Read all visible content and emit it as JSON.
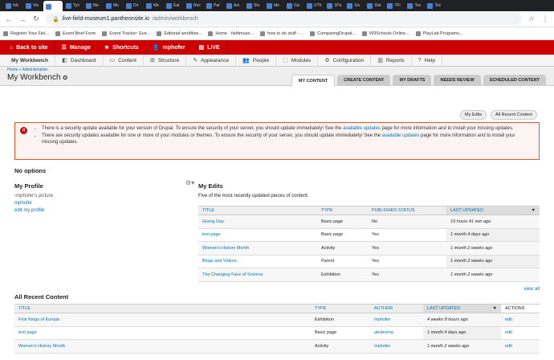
{
  "browser": {
    "tabs": [
      "Inb",
      "Vie",
      "",
      "Tyn",
      "Me",
      "Me",
      "Dir",
      "Me",
      "Ear",
      "Rec",
      "Par",
      "Asi",
      "Sto",
      "Me",
      "Giv",
      "UTh",
      "1Pa",
      "Go",
      "Dat",
      "TFi",
      "Tex",
      "Tec"
    ],
    "url_host": "live-field-museum1.pantheonsite.io",
    "url_path": "/admin/workbench",
    "bookmarks": [
      "Register Your Fiel...",
      "Event Brief Form",
      "Event Tracker: Eve...",
      "Editorial workflow...",
      "Home · fieldmuse...",
      "how to do stuff - ...",
      "ComparingDrupal...",
      "W3Schools Online...",
      "PlayLab Programs..."
    ]
  },
  "toolbar": {
    "back": "Back to site",
    "manage": "Manage",
    "shortcuts": "Shortcuts",
    "user": "mphofer",
    "live": "LIVE"
  },
  "admin_menu": [
    "My Workbench",
    "Dashboard",
    "Content",
    "Structure",
    "Appearance",
    "People",
    "Modules",
    "Configuration",
    "Reports",
    "Help"
  ],
  "breadcrumb": "Home » Administration",
  "page_title": "My Workbench",
  "page_tabs": [
    "MY CONTENT",
    "CREATE CONTENT",
    "MY DRAFTS",
    "NEEDS REVIEW",
    "SCHEDULED CONTENT"
  ],
  "mini_buttons": {
    "my_edits": "My Edits",
    "all_recent": "All Recent Content"
  },
  "messages": [
    {
      "pre": "There is a security update available for your version of Drupal. To ensure the security of your server, you should update immediately! See the ",
      "link": "available updates",
      "post": " page for more information and to install your missing updates."
    },
    {
      "pre": "There are security updates available for one or more of your modules or themes. To ensure the security of your server, you should update immediately! See the ",
      "link": "available updates",
      "post": " page for more information and to install your missing updates."
    }
  ],
  "no_options": "No options",
  "profile": {
    "title": "My Profile",
    "picture_alt": "mphofer's picture",
    "name": "mphofer",
    "edit": "edit my profile"
  },
  "my_edits": {
    "title": "My Edits",
    "desc": "Five of the most recently updated pieces of content.",
    "headers": [
      "TITLE",
      "TYPE",
      "PUBLISHED STATUS",
      "LAST UPDATED"
    ],
    "rows": [
      [
        "Giving Day",
        "Basic page",
        "No",
        "19 hours 41 min ago"
      ],
      [
        "test page",
        "Basic page",
        "Yes",
        "1 month 4 days ago"
      ],
      [
        "Women's History Month",
        "Activity",
        "Yes",
        "1 month 2 weeks ago"
      ],
      [
        "Blogs and Videos",
        "Parent",
        "Yes",
        "1 month 2 weeks ago"
      ],
      [
        "The Changing Face of Science",
        "Exhibition",
        "Yes",
        "1 month 2 weeks ago"
      ]
    ],
    "view_all": "view all"
  },
  "recent": {
    "title": "All Recent Content",
    "headers": [
      "TITLE",
      "TYPE",
      "AUTHOR",
      "LAST UPDATED",
      "ACTIONS"
    ],
    "rows": [
      [
        "First Kings of Europe",
        "Exhibition",
        "mphofer",
        "4 weeks 8 hours ago",
        "edit"
      ],
      [
        "test page",
        "Basic page",
        "aledesma",
        "1 month 4 days ago",
        "edit"
      ],
      [
        "Women's History Month",
        "Activity",
        "mphofer",
        "1 month 2 weeks ago",
        "edit"
      ]
    ]
  }
}
